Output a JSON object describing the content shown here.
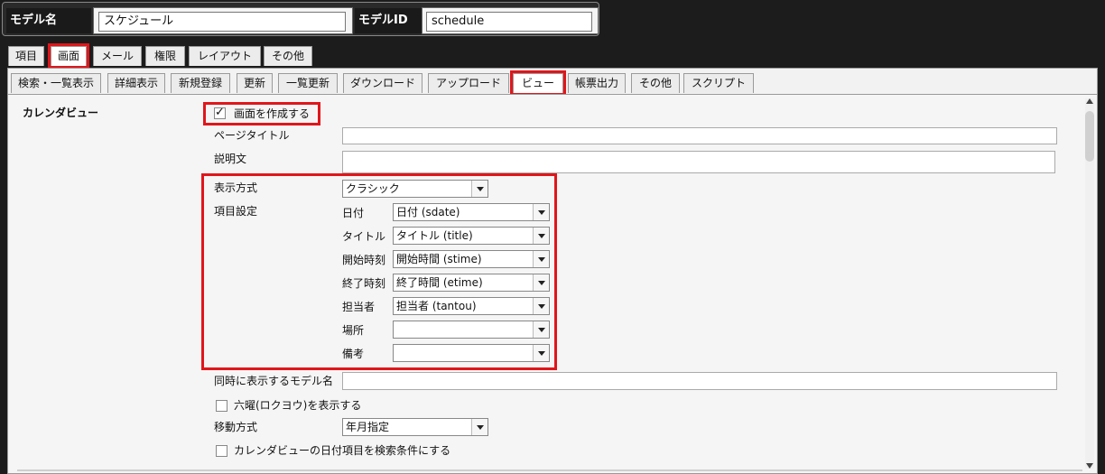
{
  "model": {
    "name_label": "モデル名",
    "name_value": "スケジュール",
    "id_label": "モデルID",
    "id_value": "schedule"
  },
  "tabs_top": [
    "項目",
    "画面",
    "メール",
    "権限",
    "レイアウト",
    "その他"
  ],
  "tabs_sub": [
    "検索・一覧表示",
    "詳細表示",
    "新規登録",
    "更新",
    "一覧更新",
    "ダウンロード",
    "アップロード",
    "ビュー",
    "帳票出力",
    "その他",
    "スクリプト"
  ],
  "section": {
    "title": "カレンダビュー",
    "create_screen": "画面を作成する",
    "page_title_label": "ページタイトル",
    "description_label": "説明文",
    "display_method_label": "表示方式",
    "display_method_value": "クラシック",
    "item_settings_label": "項目設定",
    "items": [
      {
        "label": "日付",
        "value": "日付 (sdate)"
      },
      {
        "label": "タイトル",
        "value": "タイトル (title)"
      },
      {
        "label": "開始時刻",
        "value": "開始時間 (stime)"
      },
      {
        "label": "終了時刻",
        "value": "終了時間 (etime)"
      },
      {
        "label": "担当者",
        "value": "担当者 (tantou)"
      },
      {
        "label": "場所",
        "value": ""
      },
      {
        "label": "備考",
        "value": ""
      }
    ],
    "simultaneous_label": "同時に表示するモデル名",
    "rokuyo_label": "六曜(ロクヨウ)を表示する",
    "move_method_label": "移動方式",
    "move_method_value": "年月指定",
    "search_cond_label": "カレンダビューの日付項目を検索条件にする"
  },
  "colors": {
    "highlight": "#e0161b",
    "background": "#1c1c1c"
  }
}
